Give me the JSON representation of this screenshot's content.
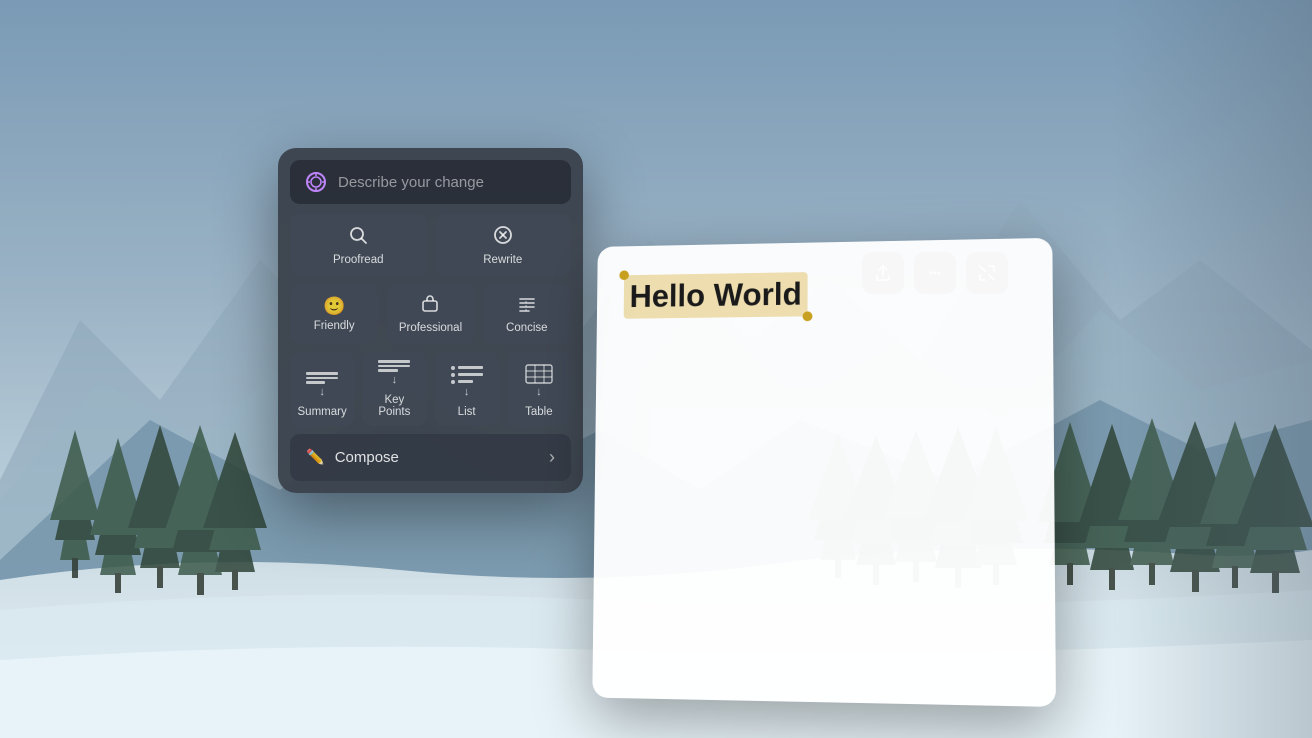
{
  "background": {
    "alt": "Winter mountain landscape with pine trees and snow"
  },
  "ai_panel": {
    "search_bar": {
      "icon_name": "ai-sparkle-icon",
      "placeholder": "Describe your change"
    },
    "buttons_row1": [
      {
        "id": "proofread",
        "icon": "🔍",
        "label": "Proofread"
      },
      {
        "id": "rewrite",
        "icon": "⊘",
        "label": "Rewrite"
      }
    ],
    "buttons_row2": [
      {
        "id": "friendly",
        "icon": "🙂",
        "label": "Friendly"
      },
      {
        "id": "professional",
        "icon": "💼",
        "label": "Professional"
      },
      {
        "id": "concise",
        "icon": "≡",
        "label": "Concise"
      }
    ],
    "buttons_row3": [
      {
        "id": "summary",
        "label": "Summary"
      },
      {
        "id": "key-points",
        "label": "Key Points"
      },
      {
        "id": "list",
        "label": "List"
      },
      {
        "id": "table",
        "label": "Table"
      }
    ],
    "compose": {
      "icon": "✏️",
      "label": "Compose",
      "arrow": "›"
    }
  },
  "doc_panel": {
    "toolbar": [
      {
        "id": "share",
        "icon": "↑",
        "label": "share-button"
      },
      {
        "id": "menu",
        "icon": "···",
        "label": "menu-button"
      },
      {
        "id": "expand",
        "icon": "⤢",
        "label": "expand-button"
      }
    ],
    "content": {
      "selected_text": "Hello World"
    }
  }
}
